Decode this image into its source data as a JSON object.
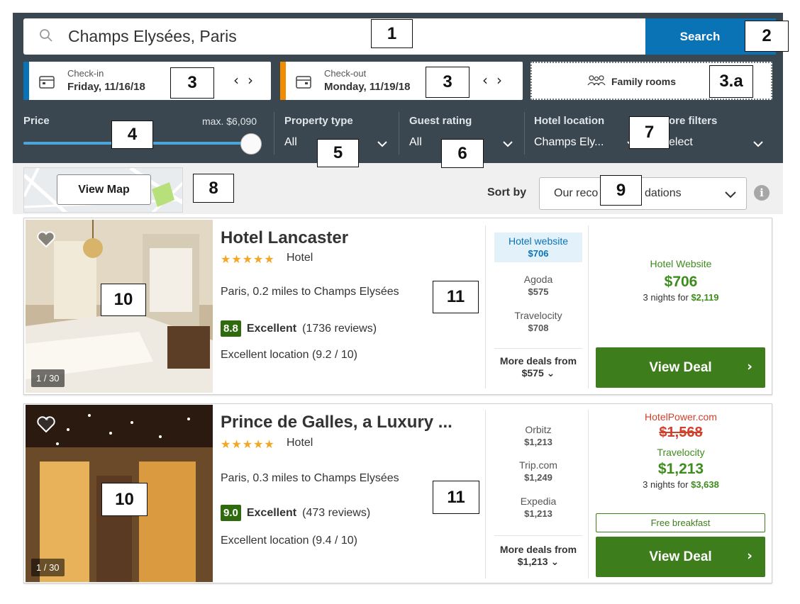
{
  "search": {
    "query": "Champs Elysées, Paris",
    "button_label": "Search"
  },
  "checkin": {
    "label": "Check-in",
    "value": "Friday, 11/16/18"
  },
  "checkout": {
    "label": "Check-out",
    "value": "Monday, 11/19/18"
  },
  "family_rooms": {
    "label": "Family rooms"
  },
  "filters": {
    "price": {
      "label": "Price",
      "max_label": "max. $6,090",
      "slider_fraction": 1.0
    },
    "property_type": {
      "label": "Property type",
      "value": "All"
    },
    "guest_rating": {
      "label": "Guest rating",
      "value": "All"
    },
    "hotel_location": {
      "label": "Hotel location",
      "value": "Champs Ely..."
    },
    "more_filters": {
      "label": "ore filters",
      "value": "elect"
    }
  },
  "map": {
    "button_label": "View Map"
  },
  "sort": {
    "label": "Sort by",
    "value_left": "Our reco",
    "value_right": "dations"
  },
  "hotels": [
    {
      "name": "Hotel Lancaster",
      "stars": "★★★★★",
      "type": "Hotel",
      "location": "Paris, 0.2 miles to Champs Elysées",
      "score": "8.8",
      "score_word": "Excellent",
      "reviews": "(1736 reviews)",
      "location_score": "Excellent location (9.2 / 10)",
      "photo_counter": "1 / 30",
      "deals": [
        {
          "site": "Hotel website",
          "price": "$706",
          "highlighted": true
        },
        {
          "site": "Agoda",
          "price": "$575"
        },
        {
          "site": "Travelocity",
          "price": "$708"
        }
      ],
      "more_deals_label": "More deals from",
      "more_deals_price": "$575",
      "best": {
        "site": "Hotel Website",
        "price": "$706",
        "nights_text": "3 nights for",
        "nights_total": "$2,119"
      },
      "cta": "View Deal"
    },
    {
      "name": "Prince de Galles, a Luxury ...",
      "stars": "★★★★★",
      "type": "Hotel",
      "location": "Paris, 0.3 miles to Champs Elysées",
      "score": "9.0",
      "score_word": "Excellent",
      "reviews": "(473 reviews)",
      "location_score": "Excellent location (9.4 / 10)",
      "photo_counter": "1 / 30",
      "deals": [
        {
          "site": "Orbitz",
          "price": "$1,213"
        },
        {
          "site": "Trip.com",
          "price": "$1,249"
        },
        {
          "site": "Expedia",
          "price": "$1,213"
        }
      ],
      "more_deals_label": "More deals from",
      "more_deals_price": "$1,213",
      "best": {
        "strike_site": "HotelPower.com",
        "strike_price": "$1,568",
        "site": "Travelocity",
        "price": "$1,213",
        "nights_text": "3 nights for",
        "nights_total": "$3,638",
        "perk": "Free breakfast"
      },
      "cta": "View Deal"
    }
  ],
  "callouts": {
    "c1": "1",
    "c2": "2",
    "c3a": "3",
    "c3b": "3",
    "c3x": "3.a",
    "c4": "4",
    "c5": "5",
    "c6": "6",
    "c7": "7",
    "c8": "8",
    "c9": "9",
    "c10a": "10",
    "c10b": "10",
    "c11a": "11",
    "c11b": "11"
  },
  "colors": {
    "header_bg": "#3a4750",
    "search_blue": "#0a73b5",
    "checkin_stripe": "#0a73b5",
    "checkout_stripe": "#f08c00",
    "deal_green": "#3d7d1b",
    "price_green": "#3d8c1c",
    "strike_red": "#d0402b",
    "star_orange": "#f5a623"
  }
}
